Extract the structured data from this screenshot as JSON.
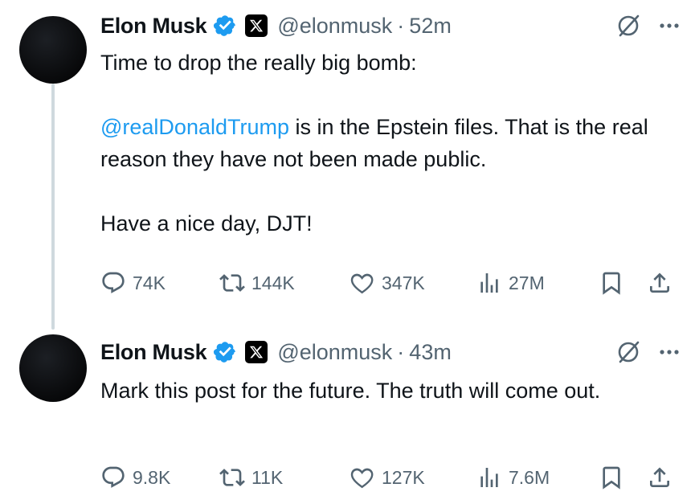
{
  "tweets": [
    {
      "author": {
        "name": "Elon Musk",
        "handle": "@elonmusk",
        "time": "52m",
        "separator": "·"
      },
      "text": {
        "line1": "Time to drop the really big bomb:",
        "mention": "@realDonaldTrump",
        "line2_rest": " is in the Epstein files. That is the real reason they have not been made public.",
        "line3": "Have a nice day, DJT!"
      },
      "stats": {
        "replies": "74K",
        "reposts": "144K",
        "likes": "347K",
        "views": "27M"
      }
    },
    {
      "author": {
        "name": "Elon Musk",
        "handle": "@elonmusk",
        "time": "43m",
        "separator": "·"
      },
      "text": {
        "line1": "Mark this post for the future. The truth will come out."
      },
      "stats": {
        "replies": "9.8K",
        "reposts": "11K",
        "likes": "127K",
        "views": "7.6M"
      }
    }
  ],
  "icons": {
    "verified": "verified-badge-icon",
    "affiliate": "x-logo-icon",
    "hide": "circle-slash-icon",
    "more": "more-dots-icon",
    "reply": "reply-bubble-icon",
    "repost": "repost-arrows-icon",
    "like": "heart-icon",
    "views": "bar-chart-icon",
    "bookmark": "bookmark-icon",
    "share": "share-upload-icon"
  },
  "colors": {
    "text": "#0f1419",
    "secondary": "#536471",
    "link": "#1d9bf0",
    "verified": "#1d9bf0",
    "thread_line": "#cfd9de"
  }
}
